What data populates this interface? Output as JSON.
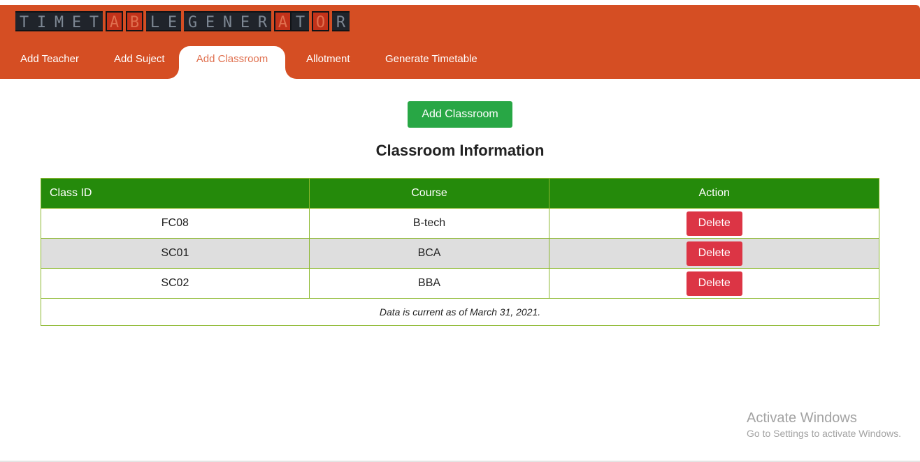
{
  "logo": {
    "letters": [
      {
        "char": "T",
        "hl": false
      },
      {
        "char": "I",
        "hl": false
      },
      {
        "char": "M",
        "hl": false
      },
      {
        "char": "E",
        "hl": false
      },
      {
        "char": "T",
        "hl": false
      },
      {
        "char": "A",
        "hl": true
      },
      {
        "char": "B",
        "hl": true
      },
      {
        "char": "L",
        "hl": false
      },
      {
        "char": "E",
        "hl": false
      },
      {
        "char": "G",
        "hl": false
      },
      {
        "char": "E",
        "hl": false
      },
      {
        "char": "N",
        "hl": false
      },
      {
        "char": "E",
        "hl": false
      },
      {
        "char": "R",
        "hl": false
      },
      {
        "char": "A",
        "hl": true
      },
      {
        "char": "T",
        "hl": false
      },
      {
        "char": "O",
        "hl": true
      },
      {
        "char": "R",
        "hl": false
      }
    ]
  },
  "nav": {
    "items": [
      {
        "label": "Add Teacher"
      },
      {
        "label": "Add Suject"
      },
      {
        "label": "Add Classroom"
      },
      {
        "label": "Allotment"
      },
      {
        "label": "Generate Timetable"
      }
    ],
    "active": "Add Classroom"
  },
  "main": {
    "add_button": "Add Classroom",
    "heading": "Classroom Information"
  },
  "table": {
    "headers": [
      "Class ID",
      "Course",
      "Action"
    ],
    "rows": [
      {
        "class_id": "FC08",
        "course": "B-tech",
        "action": "Delete"
      },
      {
        "class_id": "SC01",
        "course": "BCA",
        "action": "Delete"
      },
      {
        "class_id": "SC02",
        "course": "BBA",
        "action": "Delete"
      }
    ],
    "footer": "Data is current as of March 31, 2021."
  },
  "watermark": {
    "title": "Activate Windows",
    "subtitle": "Go to Settings to activate Windows."
  },
  "colors": {
    "header_bg": "#d54e23",
    "active_tab_text": "#e0704f",
    "add_button": "#28a745",
    "table_header": "#258a0b",
    "table_border": "#8cb82e",
    "alt_row": "#dedede",
    "delete_button": "#dc3545"
  }
}
